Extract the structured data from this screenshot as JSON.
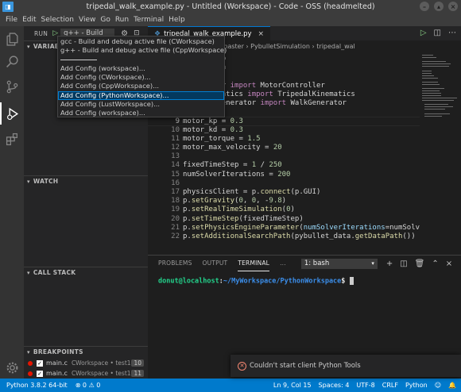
{
  "window": {
    "title": "tripedal_walk_example.py - Untitled (Workspace) - Code - OSS (headmelted)"
  },
  "menu": [
    "File",
    "Edit",
    "Selection",
    "View",
    "Go",
    "Run",
    "Terminal",
    "Help"
  ],
  "run_view": {
    "run_label": "RUN",
    "selected_config": "g++ - Build",
    "sections": {
      "variables": "VARIABLES",
      "watch": "WATCH",
      "call_stack": "CALL STACK",
      "breakpoints": "BREAKPOINTS"
    }
  },
  "config_dropdown": [
    "gcc - Build and debug active file (CWorkspace)",
    "g++ - Build and debug active file (CppWorkspace)",
    "",
    "Add Config (workspace)...",
    "Add Config (CWorkspace)...",
    "Add Config (CppWorkspace)...",
    "Add Config (PythonWorkspace)...",
    "Add Config (LustWorkspace)...",
    "Add Config (workspace)..."
  ],
  "breakpoints": [
    {
      "file": "main.c",
      "folder": "CWorkspace • test1",
      "line": "10"
    },
    {
      "file": "main.c",
      "folder": "CWorkspace • test1",
      "line": "11"
    }
  ],
  "editor": {
    "tab_label": "tripedal_walk_example.py",
    "breadcrumb": "ripedal-robot-prjoject-master › PybulletSimulation › tripedal_wal",
    "lines": [
      {
        "n": "",
        "text": "ullet as p"
      },
      {
        "n": "",
        "text": "ullet_data"
      },
      {
        "n": "",
        "text": ""
      },
      {
        "n": "",
        "text": "Controller import MotorController"
      },
      {
        "n": "",
        "text": "dal_kinematics import TripedalKinematics"
      },
      {
        "n": "",
        "text": "dal_walkGenerator import WalkGenerator"
      },
      {
        "n": "8",
        "text": ""
      },
      {
        "n": "9",
        "text": "motor_kp = 0.3"
      },
      {
        "n": "10",
        "text": "motor_kd = 0.3"
      },
      {
        "n": "11",
        "text": "motor_torque = 1.5"
      },
      {
        "n": "12",
        "text": "motor_max_velocity = 20"
      },
      {
        "n": "13",
        "text": ""
      },
      {
        "n": "14",
        "text": "fixedTimeStep = 1 / 250"
      },
      {
        "n": "15",
        "text": "numSolverIterations = 200"
      },
      {
        "n": "16",
        "text": ""
      },
      {
        "n": "17",
        "text": "physicsClient = p.connect(p.GUI)"
      },
      {
        "n": "18",
        "text": "p.setGravity(0, 0, -9.8)"
      },
      {
        "n": "19",
        "text": "p.setRealTimeSimulation(0)"
      },
      {
        "n": "20",
        "text": "p.setTimeStep(fixedTimeStep)"
      },
      {
        "n": "21",
        "text": "p.setPhysicsEngineParameter(numSolverIterations=numSolverI"
      },
      {
        "n": "22",
        "text": "p.setAdditionalSearchPath(pybullet_data.getDataPath())"
      }
    ]
  },
  "panel": {
    "tabs": [
      "PROBLEMS",
      "OUTPUT",
      "TERMINAL",
      "..."
    ],
    "terminal_select": "1: bash",
    "prompt_user": "donut@localhost",
    "prompt_path": "~/MyWorkspace/PythonWorkspace",
    "prompt_symbol": "$",
    "prompt_sep": ":"
  },
  "notification": {
    "message": "Couldn't start client Python Tools"
  },
  "status": {
    "python": "Python 3.8.2 64-bit",
    "problems": "⊗ 0 ⚠ 0",
    "position": "Ln 9, Col 15",
    "spaces": "Spaces: 4",
    "encoding": "UTF-8",
    "eol": "CRLF",
    "language": "Python"
  },
  "colors": {
    "accent": "#007acc",
    "selection": "#094771",
    "breakpoint": "#e51400",
    "terminal_user": "#23d18b",
    "terminal_path": "#3b8eea"
  }
}
